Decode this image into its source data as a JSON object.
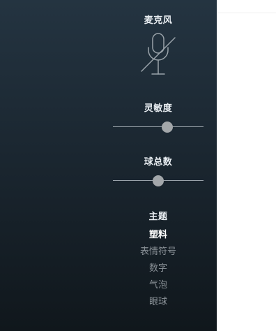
{
  "microphone": {
    "label": "麦克风",
    "icon": "mic-off-icon",
    "muted": true
  },
  "sensitivity": {
    "label": "灵敏度",
    "value": 0.6
  },
  "ball_count": {
    "label": "球总数",
    "value": 0.5
  },
  "theme": {
    "label": "主题",
    "items": [
      {
        "label": "塑料",
        "selected": true
      },
      {
        "label": "表情符号",
        "selected": false
      },
      {
        "label": "数字",
        "selected": false
      },
      {
        "label": "气泡",
        "selected": false
      },
      {
        "label": "眼球",
        "selected": false
      }
    ]
  },
  "colors": {
    "panel_top": "#243441",
    "panel_bottom": "#10171c",
    "text_active": "#ffffff",
    "text_inactive": "#8a9197",
    "thumb": "#a3a7aa"
  }
}
